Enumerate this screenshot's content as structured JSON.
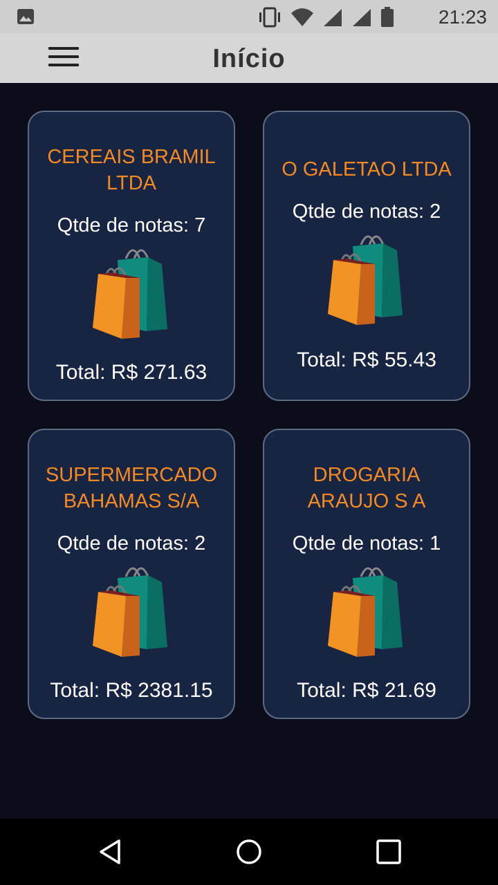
{
  "status_bar": {
    "time": "21:23",
    "icons": [
      "image-icon",
      "vibrate-icon",
      "wifi-icon",
      "signal-icon",
      "signal-icon",
      "battery-icon"
    ]
  },
  "app_bar": {
    "title": "Início",
    "menu_icon": "hamburger-menu-icon"
  },
  "stores": [
    {
      "name": "CEREAIS BRAMIL LTDA",
      "qty": "Qtde de notas: 7",
      "total": "Total: R$ 271.63"
    },
    {
      "name": "O GALETAO LTDA",
      "qty": "Qtde de notas: 2",
      "total": "Total: R$ 55.43"
    },
    {
      "name": "SUPERMERCADO BAHAMAS S/A",
      "qty": "Qtde de notas: 2",
      "total": "Total: R$ 2381.15"
    },
    {
      "name": "DROGARIA ARAUJO S A",
      "qty": "Qtde de notas: 1",
      "total": "Total: R$ 21.69"
    }
  ],
  "card_icon": "shopping-bags-icon",
  "colors": {
    "background": "#0b0e1a",
    "card": "#172543",
    "card_border": "#5c6b82",
    "store_name": "#f58a22",
    "app_bar": "#d6d6d6"
  },
  "nav_bar": {
    "buttons": [
      "back-triangle-icon",
      "home-circle-icon",
      "recents-square-icon"
    ]
  }
}
